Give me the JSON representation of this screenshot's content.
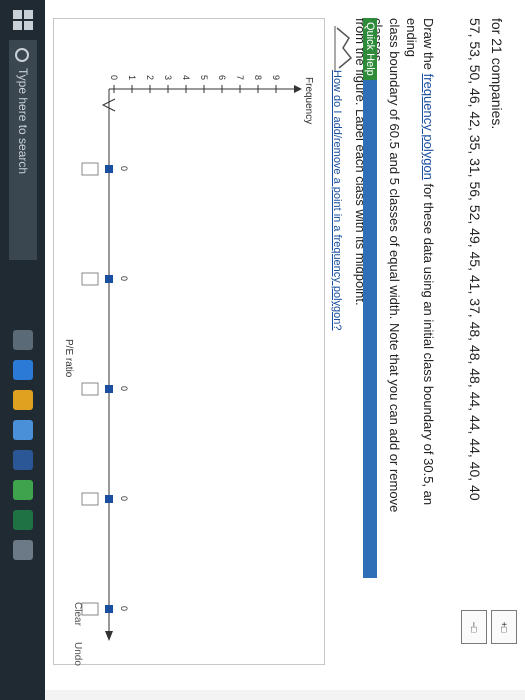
{
  "header": {
    "intro": "for 21 companies.",
    "values_line": "57, 53, 50, 46, 42, 35, 31, 56, 52, 49, 45, 41, 37, 48, 48, 48, 44, 44, 44, 40, 40"
  },
  "instructions": {
    "prefix": "Draw the",
    "link": "frequency polygon",
    "line1_rest": " for these data using an initial class boundary of 30.5, an ending",
    "line2": "class boundary of 60.5 and 5 classes of equal width. Note that you can add or remove classes",
    "line3": "from the figure. Label each class with its midpoint."
  },
  "quick_help": {
    "label": "Quick Help",
    "link": "How do I add/remove a point in a frequency polygon?"
  },
  "graph": {
    "y_axis_label": "Frequency",
    "y_ticks": [
      "0",
      "1",
      "2",
      "3",
      "4",
      "5",
      "6",
      "7",
      "8",
      "9"
    ],
    "x_axis_label": "P/E ratio",
    "point_values": [
      "0",
      "0",
      "0",
      "0",
      "0"
    ]
  },
  "tools": {
    "clear": "Clear",
    "undo": "Undo"
  },
  "taskbar": {
    "search_placeholder": "Type here to search"
  }
}
